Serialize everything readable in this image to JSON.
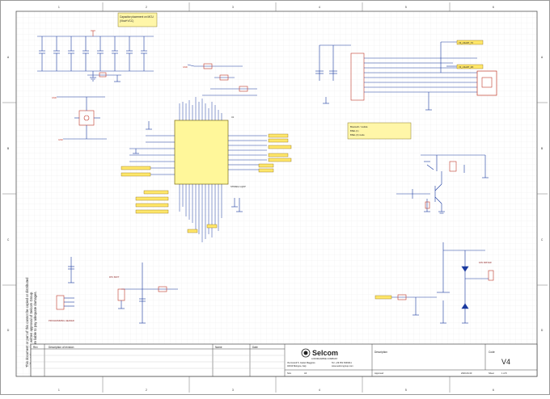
{
  "sheet": {
    "col_markers": [
      "1",
      "2",
      "3",
      "4",
      "5",
      "6"
    ],
    "row_markers": [
      "A",
      "B",
      "C",
      "D"
    ],
    "notice": [
      "This document or part of this cannot be copied or distributed",
      "without the prior written approval of Selcom Group.",
      "Any offenders are liable to pay adequate damages."
    ]
  },
  "notes": {
    "top": [
      "Capacitor placement on MCU",
      "(Vbat+VCC)"
    ],
    "mid": [
      "Bluetooth / module",
      "BSEL (1)",
      "BSEL (0) mode"
    ]
  },
  "mcu": {
    "ref": "U1",
    "part": "STM32L4 LQFP"
  },
  "nets": {
    "usart_tx": "V3_USART_TX",
    "usart_rx": "V3_USART_RX",
    "i2c_scl": "I2C_SCL",
    "i2c_sda": "I2C_SDA",
    "gnd": "GND",
    "vcc": "+3V3",
    "fan_driver": "FAN DRIVER",
    "prog": "PROGRAMMING HEADER",
    "rtc": "RTC BATT"
  },
  "title_block": {
    "rev_header": "Rev",
    "desc_header": "Description of revision",
    "name_header": "Name",
    "date_header": "Date",
    "company": "Selcom",
    "company_tag": "A WORLDWIDE COMPANY",
    "address": [
      "Via Grandi 5, Castel Maggiore",
      "40013 Bologna, Italy"
    ],
    "contact": [
      "Tel: +39 051 6309411",
      "www.selcomgroup.com"
    ],
    "description_label": "Description",
    "code_label": "Code",
    "version": "V4",
    "size_label": "Size",
    "size_value": "A3",
    "approved_label": "Approved",
    "date_value": "2020-09-30",
    "sheet_label": "Sheet",
    "sheet_value": "1 of 8"
  }
}
